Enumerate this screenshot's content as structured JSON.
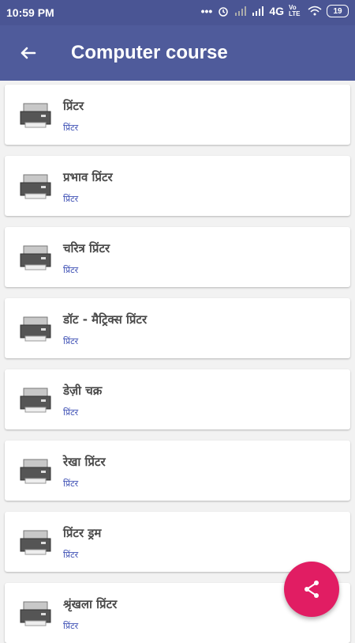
{
  "status_bar": {
    "time": "10:59 PM",
    "network": "4G",
    "volte": "Vo LTE",
    "battery": "19",
    "icons": [
      "more-dots-icon",
      "alarm-icon",
      "signal-icon",
      "signal-icon",
      "wifi-icon",
      "battery-icon"
    ]
  },
  "app_bar": {
    "title": "Computer course",
    "back_icon": "arrow-back-icon"
  },
  "list": {
    "items": [
      {
        "title": "प्रिंटर",
        "subtitle": "प्रिंटर"
      },
      {
        "title": "प्रभाव प्रिंटर",
        "subtitle": "प्रिंटर"
      },
      {
        "title": "चरित्र प्रिंटर",
        "subtitle": "प्रिंटर"
      },
      {
        "title": "डॉट - मैट्रिक्स प्रिंटर",
        "subtitle": "प्रिंटर"
      },
      {
        "title": "डेज़ी चक्र",
        "subtitle": "प्रिंटर"
      },
      {
        "title": "रेखा प्रिंटर",
        "subtitle": "प्रिंटर"
      },
      {
        "title": "प्रिंटर ड्रम",
        "subtitle": "प्रिंटर"
      },
      {
        "title": "श्रृंखला प्रिंटर",
        "subtitle": "प्रिंटर"
      }
    ]
  },
  "fab": {
    "icon": "share-icon",
    "color": "#e11d63"
  },
  "colors": {
    "appbar": "#4f5b9b",
    "statusbar": "#4a5594",
    "accent": "#3f51b5"
  }
}
